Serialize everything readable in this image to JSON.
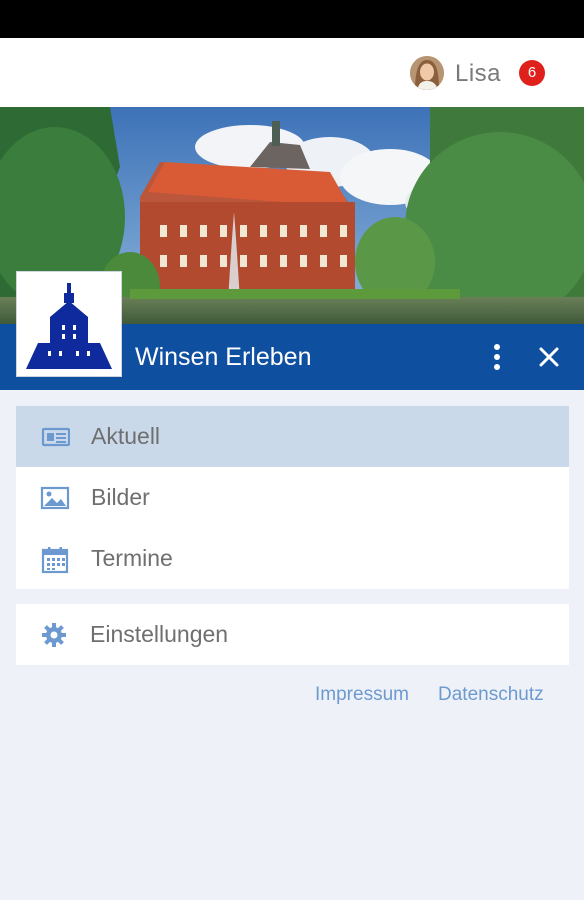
{
  "user": {
    "name": "Lisa",
    "notification_count": "6"
  },
  "header": {
    "title": "Winsen Erleben"
  },
  "menu": {
    "main_items": [
      {
        "label": "Aktuell",
        "icon": "newspaper-icon",
        "active": true
      },
      {
        "label": "Bilder",
        "icon": "image-icon",
        "active": false
      },
      {
        "label": "Termine",
        "icon": "calendar-icon",
        "active": false
      }
    ],
    "settings_item": {
      "label": "Einstellungen",
      "icon": "gear-icon"
    }
  },
  "footer": {
    "impressum": "Impressum",
    "datenschutz": "Datenschutz"
  },
  "colors": {
    "primary": "#0f4fa0",
    "active_item": "#c9d9ea",
    "badge": "#e0201b",
    "link": "#6c9ad0",
    "background": "#eef2f8"
  }
}
